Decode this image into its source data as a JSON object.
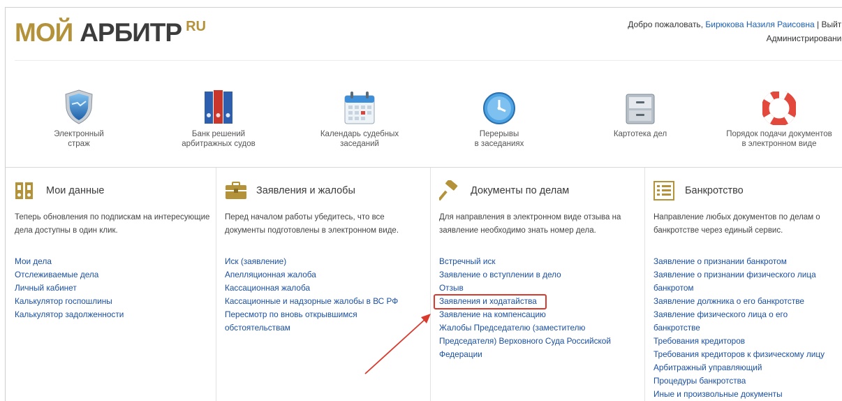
{
  "header": {
    "logo": {
      "part1": "МОЙ",
      "part2": "АРБИТР",
      "suffix": "RU"
    },
    "welcome_prefix": "Добро пожаловать,",
    "user_name": "Бирюкова Назиля Раисовна",
    "separator": "|",
    "logout": "Выйти",
    "admin": "Администрирование"
  },
  "quick_links": [
    {
      "line1": "Электронный",
      "line2": "страж",
      "icon": "shield-icon"
    },
    {
      "line1": "Банк решений",
      "line2": "арбитражных судов",
      "icon": "binders-icon"
    },
    {
      "line1": "Календарь судебных",
      "line2": "заседаний",
      "icon": "calendar-icon"
    },
    {
      "line1": "Перерывы",
      "line2": "в заседаниях",
      "icon": "clock-icon"
    },
    {
      "line1": "Картотека дел",
      "line2": "",
      "icon": "file-cabinet-icon"
    },
    {
      "line1": "Порядок подачи документов",
      "line2": "в электронном виде",
      "icon": "lifebuoy-icon"
    }
  ],
  "columns": [
    {
      "title": "Мои данные",
      "icon": "folders-icon",
      "desc": "Теперь обновления по подпискам на интересующие дела доступны в один клик.",
      "links": [
        "Мои дела",
        "Отслеживаемые дела",
        "Личный кабинет",
        "Калькулятор госпошлины",
        "Калькулятор задолженности"
      ]
    },
    {
      "title": "Заявления и жалобы",
      "icon": "briefcase-icon",
      "desc": "Перед началом работы убедитесь, что все документы подготовлены в электронном виде.",
      "links": [
        "Иск (заявление)",
        "Апелляционная жалоба",
        "Кассационная жалоба",
        "Кассационные и надзорные жалобы в ВС РФ",
        "Пересмотр по вновь открывшимся обстоятельствам"
      ]
    },
    {
      "title": "Документы по делам",
      "icon": "gavel-icon",
      "desc": "Для направления в электронном виде отзыва на заявление необходимо знать номер дела.",
      "links": [
        "Встречный иск",
        "Заявление о вступлении в дело",
        "Отзыв",
        "Заявления и ходатайства",
        "Заявление на компенсацию",
        "Жалобы Председателю (заместителю Председателя) Верховного Суда Российской Федерации"
      ]
    },
    {
      "title": "Банкротство",
      "icon": "list-icon",
      "desc": "Направление любых документов по делам о банкротстве через единый сервис.",
      "links": [
        "Заявление о признании банкротом",
        "Заявление о признании физического лица банкротом",
        "Заявление должника о его банкротстве",
        "Заявление физического лица о его банкротстве",
        "Требования кредиторов",
        "Требования кредиторов к физическому лицу",
        "Арбитражный управляющий",
        "Процедуры банкротства",
        "Иные и произвольные документы"
      ]
    }
  ],
  "colors": {
    "gold": "#b39239",
    "link": "#1a4fa0",
    "highlight": "#d93a2e"
  }
}
